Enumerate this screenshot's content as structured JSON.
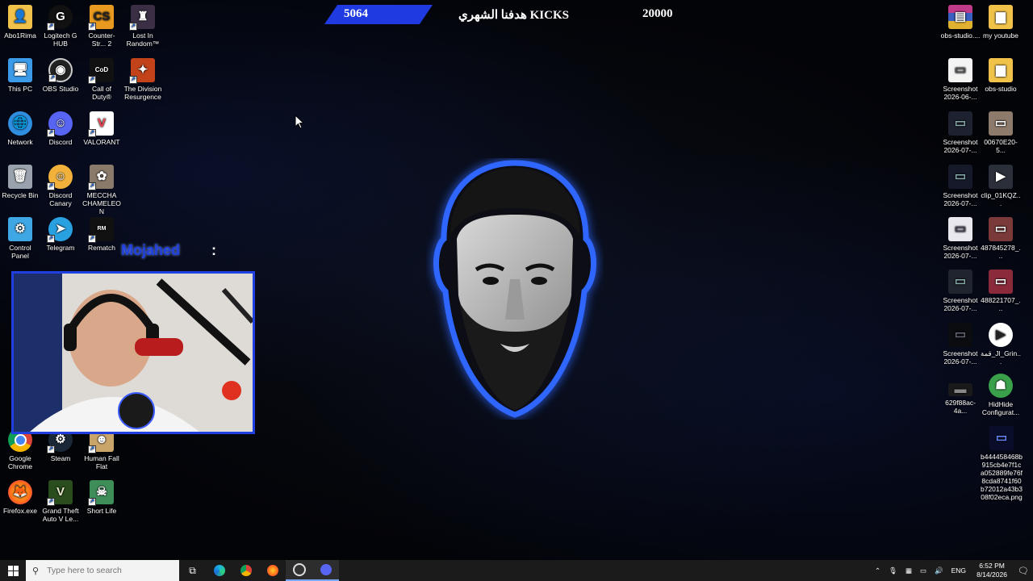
{
  "overlay": {
    "goal_current": "5064",
    "goal_title": "هدفنا الشهري KICKS",
    "goal_target": "20000"
  },
  "streamer": {
    "name": "Mojahed",
    "separator": ":"
  },
  "desktop_icons_left": [
    {
      "label": "Abo1Rima",
      "icon": "user-folder-icon"
    },
    {
      "label": "Logitech G HUB",
      "icon": "logitech-icon"
    },
    {
      "label": "Counter-Str... 2",
      "icon": "counter-strike-icon"
    },
    {
      "label": "Lost In Random™",
      "icon": "game-icon"
    },
    {
      "label": "This PC",
      "icon": "computer-icon"
    },
    {
      "label": "OBS Studio",
      "icon": "obs-icon"
    },
    {
      "label": "Call of Duty®",
      "icon": "call-of-duty-icon"
    },
    {
      "label": "The Division Resurgence",
      "icon": "division-icon"
    },
    {
      "label": "Network",
      "icon": "network-icon"
    },
    {
      "label": "Discord",
      "icon": "discord-icon"
    },
    {
      "label": "VALORANT",
      "icon": "valorant-icon"
    },
    {
      "label": "Recycle Bin",
      "icon": "recycle-bin-icon"
    },
    {
      "label": "Discord Canary",
      "icon": "discord-canary-icon"
    },
    {
      "label": "MECCHA CHAMELEON",
      "icon": "game-icon"
    },
    {
      "label": "Control Panel",
      "icon": "control-panel-icon"
    },
    {
      "label": "Telegram",
      "icon": "telegram-icon"
    },
    {
      "label": "Rematch",
      "icon": "rematch-icon"
    },
    {
      "label": "Google Chrome",
      "icon": "chrome-icon"
    },
    {
      "label": "Steam",
      "icon": "steam-icon"
    },
    {
      "label": "Human Fall Flat",
      "icon": "game-icon"
    },
    {
      "label": "Firefox.exe",
      "icon": "firefox-icon"
    },
    {
      "label": "Grand Theft Auto V Le...",
      "icon": "gta-icon"
    },
    {
      "label": "Short Life",
      "icon": "game-icon"
    }
  ],
  "desktop_icons_right": [
    {
      "label": "obs-studio....",
      "icon": "winrar-icon"
    },
    {
      "label": "my youtube",
      "icon": "folder-icon"
    },
    {
      "label": "Screenshot 2026-06-...",
      "icon": "image-file-icon"
    },
    {
      "label": "obs-studio",
      "icon": "folder-icon"
    },
    {
      "label": "Screenshot 2026-07-...",
      "icon": "image-file-icon"
    },
    {
      "label": "00670E20-5...",
      "icon": "image-file-icon"
    },
    {
      "label": "Screenshot 2026-07-...",
      "icon": "image-file-icon"
    },
    {
      "label": "clip_01KQZ...",
      "icon": "video-file-icon"
    },
    {
      "label": "Screenshot 2026-07-...",
      "icon": "image-file-icon"
    },
    {
      "label": "487845278_...",
      "icon": "image-file-icon"
    },
    {
      "label": "Screenshot 2026-07-...",
      "icon": "image-file-icon"
    },
    {
      "label": "488221707_...",
      "icon": "image-file-icon"
    },
    {
      "label": "Screenshot 2026-07-...",
      "icon": "image-file-icon"
    },
    {
      "label": "قمة_Jl_Grin...",
      "icon": "video-file-icon"
    },
    {
      "label": "629f88ac-4a...",
      "icon": "image-file-icon"
    },
    {
      "label": "HidHide Configurat...",
      "icon": "hidhide-icon"
    },
    {
      "label": "b444458468b915cb4e7f1ca052889fe76f8cda8741f60b72012a43b308f02eca.png",
      "icon": "image-file-icon"
    }
  ],
  "taskbar": {
    "search_placeholder": "Type here to search",
    "apps": [
      "task-view-icon",
      "edge-icon",
      "chrome-icon",
      "firefox-icon",
      "obs-icon",
      "discord-icon"
    ],
    "language": "ENG",
    "time": "6:52 PM",
    "date": "8/14/2026"
  },
  "colors": {
    "accent": "#1f3fe0",
    "taskbar": "#1b1b1b"
  }
}
